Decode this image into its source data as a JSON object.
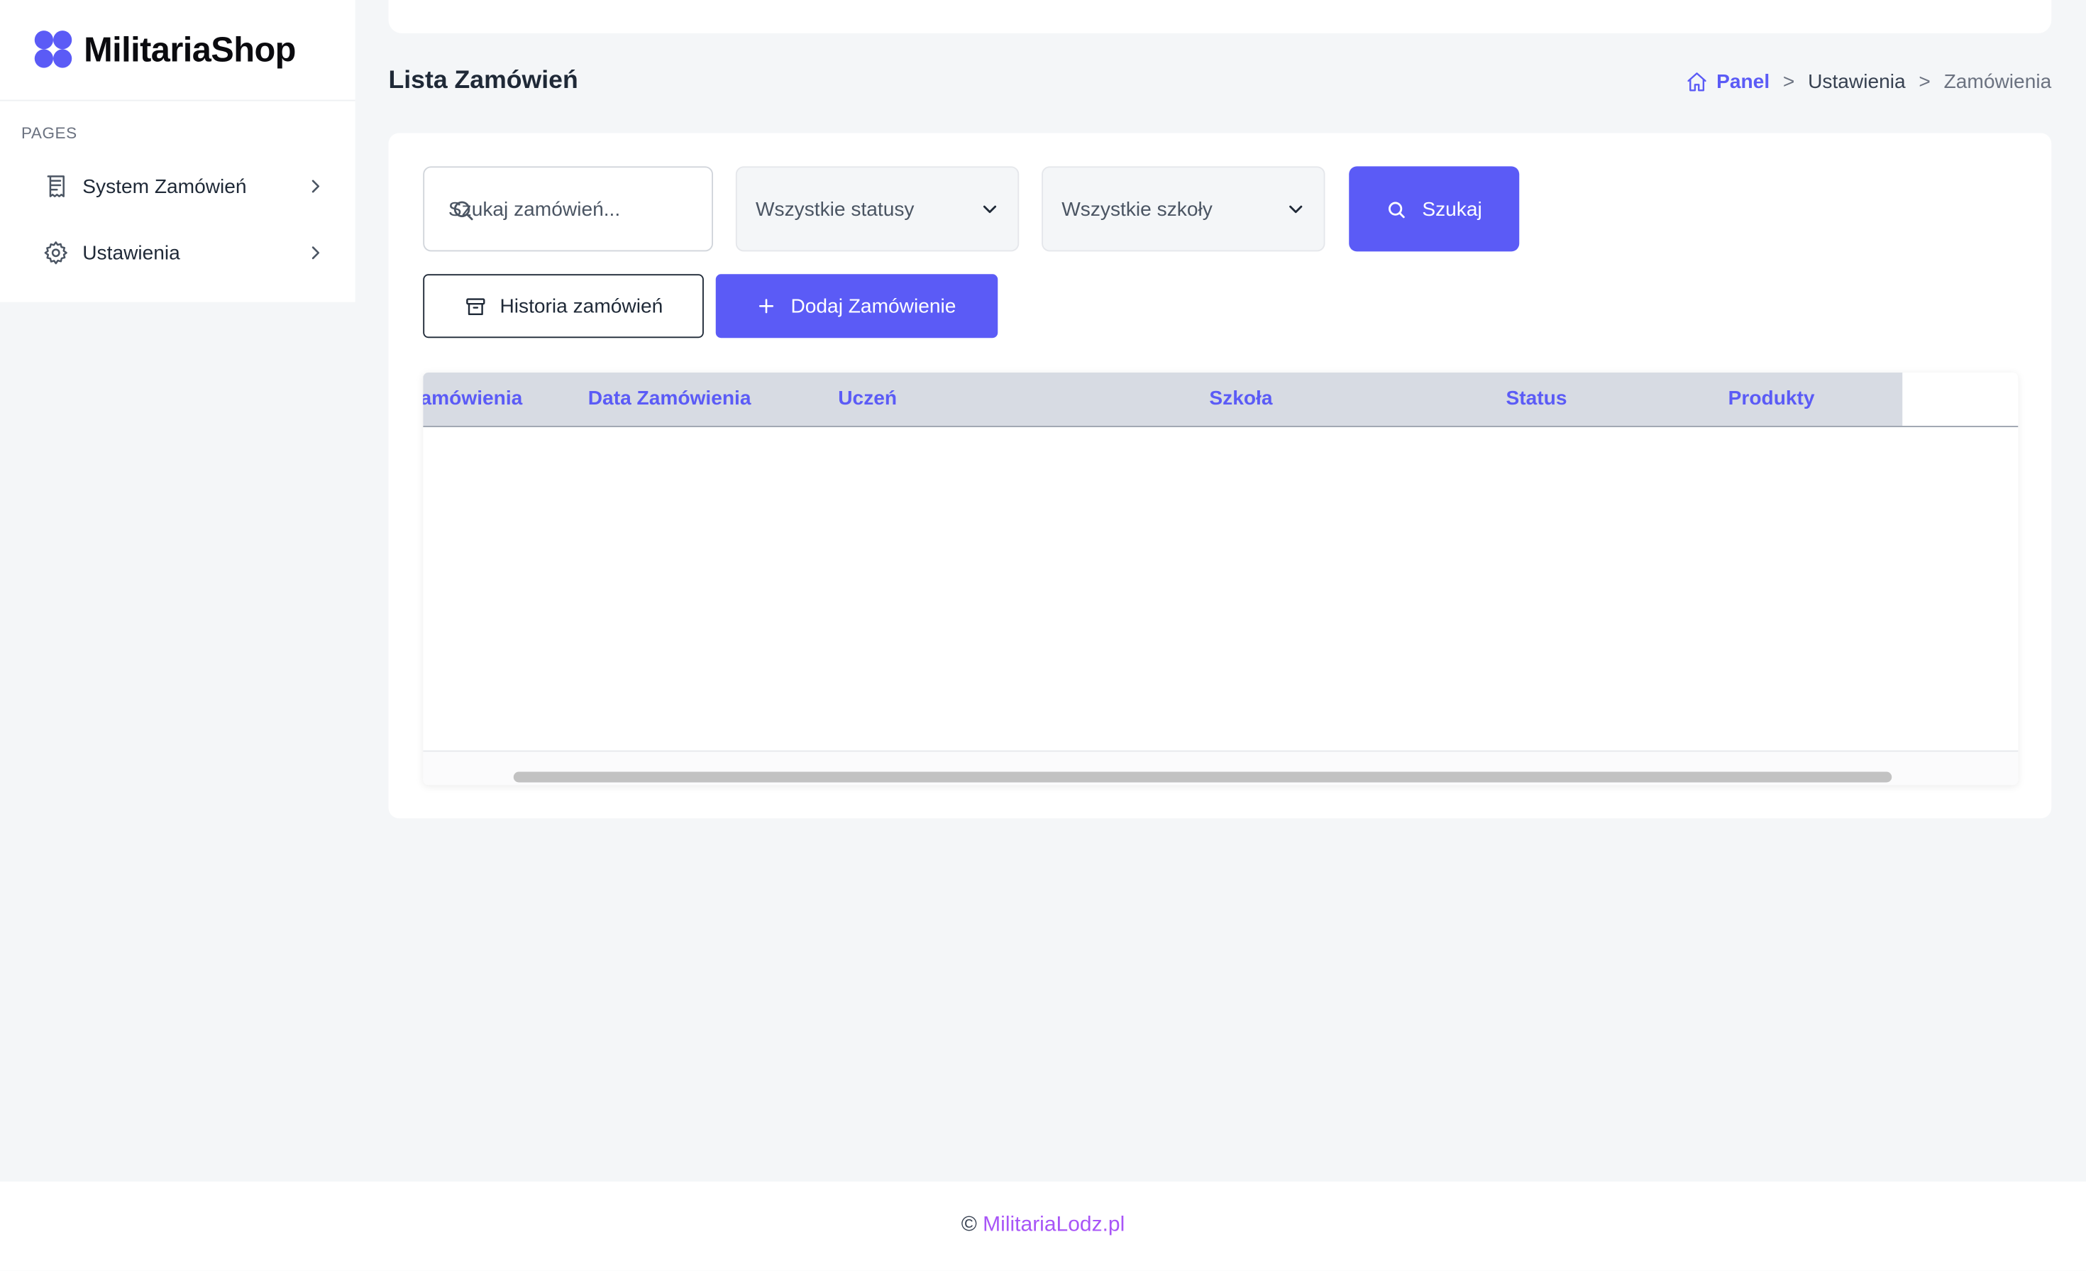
{
  "brand": {
    "name": "MilitariaShop"
  },
  "sidebar": {
    "section_label": "PAGES",
    "items": [
      {
        "label": "System Zamówień",
        "icon": "receipt-icon"
      },
      {
        "label": "Ustawienia",
        "icon": "gear-icon"
      }
    ]
  },
  "header": {
    "title": "Lista Zamówień",
    "breadcrumb": {
      "home": "Panel",
      "separator": ">",
      "middle": "Ustawienia",
      "current": "Zamówienia"
    }
  },
  "filters": {
    "search_placeholder": "Szukaj zamówień...",
    "status_select": "Wszystkie statusy",
    "school_select": "Wszystkie szkoły",
    "search_button": "Szukaj"
  },
  "actions": {
    "history_button": "Historia zamówień",
    "add_button": "Dodaj Zamówienie"
  },
  "table": {
    "columns": [
      "Nr Zamówienia",
      "Data Zamówienia",
      "Uczeń",
      "Szkoła",
      "Status",
      "Produkty"
    ],
    "rows": []
  },
  "footer": {
    "copyright": "©",
    "link_text": "MilitariaLodz.pl"
  },
  "colors": {
    "accent": "#5b5bf6",
    "footer_link": "#a855f7",
    "table_header_bg": "#d7dbe3",
    "page_bg": "#f4f6f8"
  }
}
